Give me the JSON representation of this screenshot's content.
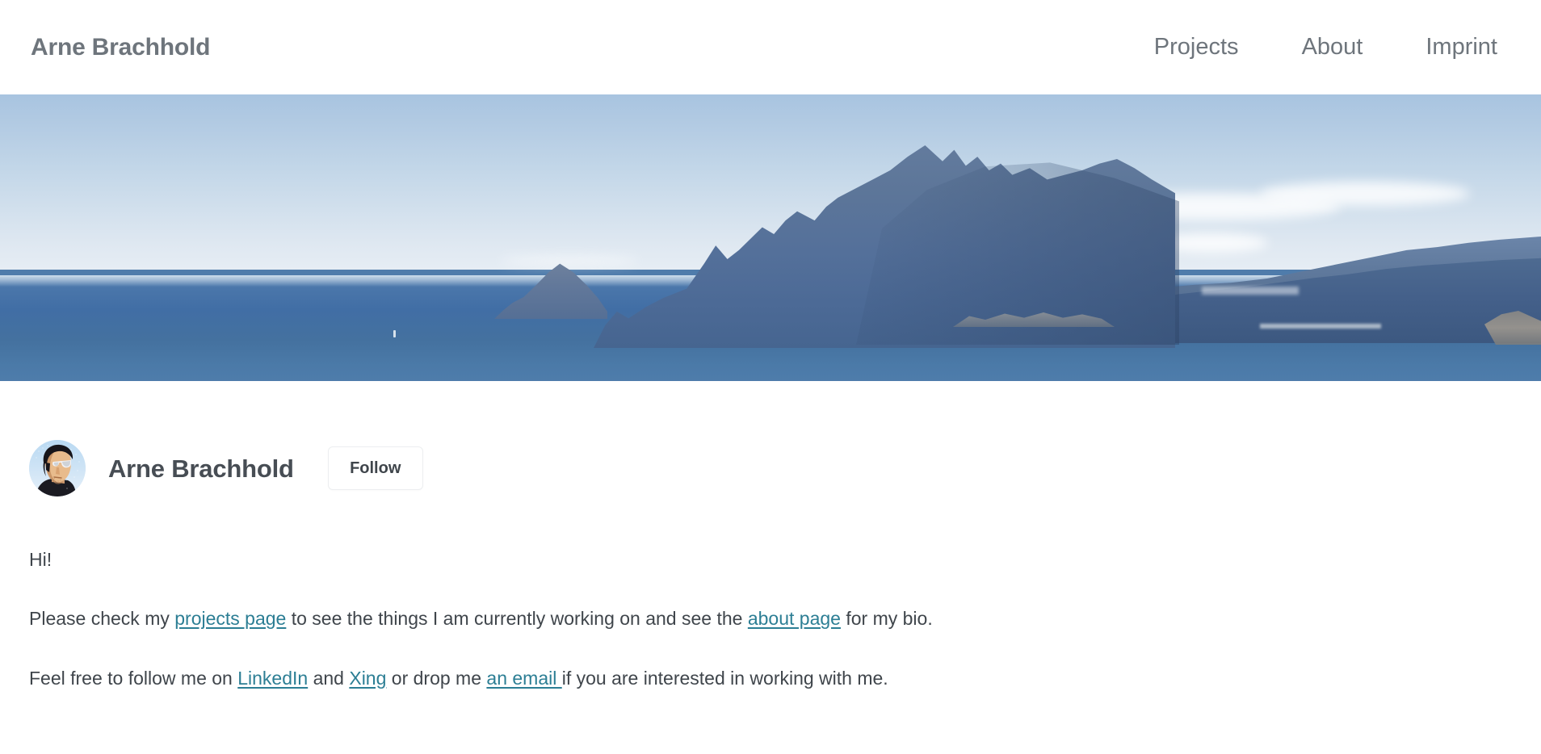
{
  "header": {
    "site_title": "Arne Brachhold",
    "nav": [
      {
        "label": "Projects",
        "name": "nav-link-projects"
      },
      {
        "label": "About",
        "name": "nav-link-about"
      },
      {
        "label": "Imprint",
        "name": "nav-link-imprint"
      }
    ]
  },
  "hero": {
    "alt": "coastal landscape with rocky headland over blue sea",
    "sky_color": "#b3cbe3",
    "sea_color": "#44719f",
    "mountain_color": "#5d7699"
  },
  "profile": {
    "avatar_alt": "portrait of Arne Brachhold wearing sunglasses",
    "name": "Arne Brachhold",
    "follow_label": "Follow"
  },
  "content": {
    "greeting": "Hi!",
    "paragraph_2": {
      "part_1": "Please check my ",
      "link_1": "projects page",
      "part_2": " to see the things I am currently working on and see the ",
      "link_2": "about page",
      "part_3": " for my bio."
    },
    "paragraph_3": {
      "part_1": "Feel free to follow me on ",
      "link_1": "LinkedIn",
      "part_2": " and ",
      "link_2": "Xing",
      "part_3": " or drop me ",
      "link_3": "an email ",
      "part_4": "if you are interested in working with me."
    }
  },
  "colors": {
    "link": "#2c7e94",
    "text": "#3f454b",
    "header_text": "#6e757c"
  }
}
